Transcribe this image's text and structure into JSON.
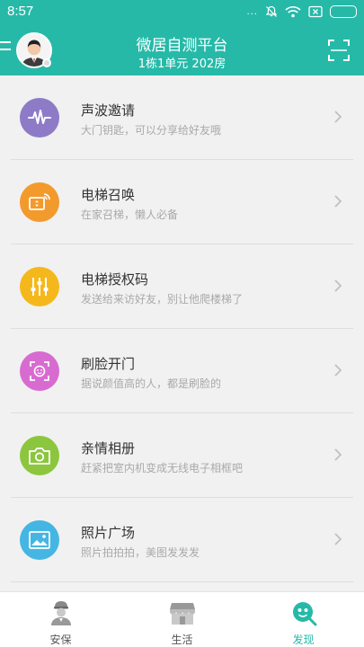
{
  "status_bar": {
    "time": "8:57",
    "dots": "..."
  },
  "header": {
    "title": "微居自测平台",
    "subtitle": "1栋1单元 202房"
  },
  "colors": {
    "accent": "#26b9a8"
  },
  "items": [
    {
      "name": "声波邀请",
      "desc": "大门钥匙，可以分享给好友哦",
      "icon": "sound-wave-icon",
      "color": "#8d7bc8"
    },
    {
      "name": "电梯召唤",
      "desc": "在家召梯，懒人必备",
      "icon": "elevator-call-icon",
      "color": "#f39a2c"
    },
    {
      "name": "电梯授权码",
      "desc": "发送给来访好友，别让他爬楼梯了",
      "icon": "sliders-icon",
      "color": "#f5b81c"
    },
    {
      "name": "刷脸开门",
      "desc": "据说颜值高的人，都是刷脸的",
      "icon": "face-scan-icon",
      "color": "#d86bd0"
    },
    {
      "name": "亲情相册",
      "desc": "赶紧把室内机变成无线电子相框吧",
      "icon": "camera-icon",
      "color": "#8cc63e"
    },
    {
      "name": "照片广场",
      "desc": "照片拍拍拍，美图发发发",
      "icon": "picture-icon",
      "color": "#45b6e3"
    }
  ],
  "tabs": [
    {
      "label": "安保",
      "icon": "guard-icon"
    },
    {
      "label": "生活",
      "icon": "shop-icon"
    },
    {
      "label": "发现",
      "icon": "discover-icon",
      "active": true
    }
  ]
}
